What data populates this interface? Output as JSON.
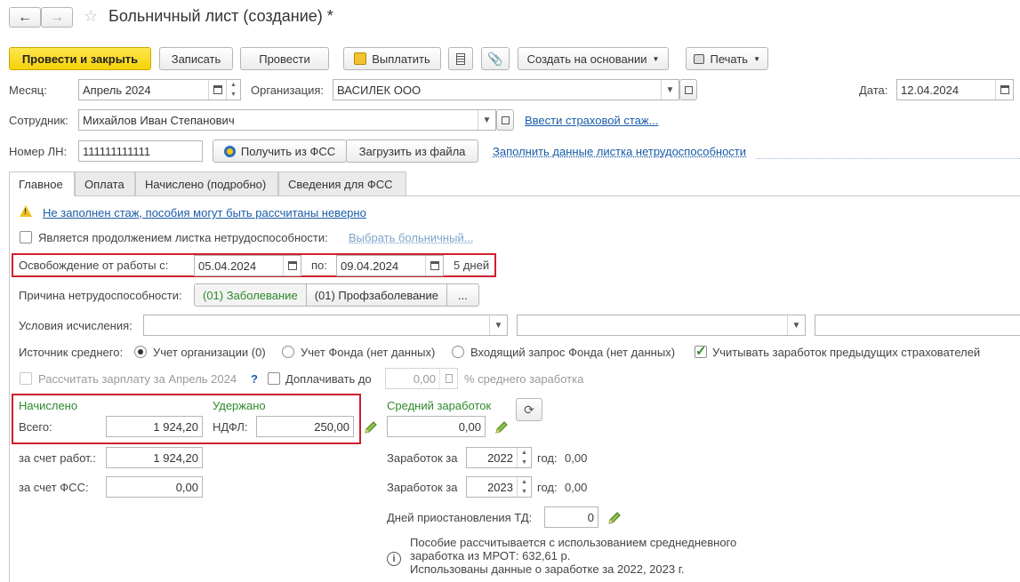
{
  "header": {
    "title": "Больничный лист (создание) *"
  },
  "toolbar": {
    "post_close": "Провести и закрыть",
    "save": "Записать",
    "post": "Провести",
    "pay": "Выплатить",
    "create_based": "Создать на основании",
    "print": "Печать"
  },
  "fields": {
    "month_label": "Месяц:",
    "month_value": "Апрель 2024",
    "org_label": "Организация:",
    "org_value": "ВАСИЛЕК ООО",
    "date_label": "Дата:",
    "date_value": "12.04.2024",
    "employee_label": "Сотрудник:",
    "employee_value": "Михайлов Иван Степанович",
    "insurance_link": "Ввести страховой стаж...",
    "ln_label": "Номер ЛН:",
    "ln_value": "111111111111",
    "get_fss": "Получить из ФСС",
    "load_file": "Загрузить из файла",
    "fill_link": "Заполнить данные листка нетрудоспособности"
  },
  "tabs": [
    "Главное",
    "Оплата",
    "Начислено (подробно)",
    "Сведения для ФСС"
  ],
  "main": {
    "warning_link": "Не заполнен стаж, пособия могут быть рассчитаны неверно",
    "continuation_label": "Является продолжением листка нетрудоспособности:",
    "choose_sick": "Выбрать больничный...",
    "release_label": "Освобождение от работы с:",
    "release_from": "05.04.2024",
    "to_label": "по:",
    "release_to": "09.04.2024",
    "days": "5 дней",
    "reason_label": "Причина нетрудоспособности:",
    "reason_options": [
      "(01) Заболевание",
      "(01) Профзаболевание",
      "..."
    ],
    "conditions_label": "Условия исчисления:",
    "source_label": "Источник среднего:",
    "source_options": [
      "Учет организации (0)",
      "Учет Фонда (нет данных)",
      "Входящий запрос Фонда (нет данных)"
    ],
    "prev_employers": "Учитывать заработок предыдущих страхователей",
    "calc_salary": "Рассчитать зарплату за Апрель 2024",
    "question": "?",
    "extra_pay": "Доплачивать до",
    "extra_value": "0,00",
    "percent_label": "% среднего заработка",
    "accrued_title": "Начислено",
    "total_label": "Всего:",
    "total_value": "1 924,20",
    "withheld_title": "Удержано",
    "ndfl_label": "НДФЛ:",
    "ndfl_value": "250,00",
    "employer_label": "за счет работ.:",
    "employer_value": "1 924,20",
    "fss_label": "за счет ФСС:",
    "fss_value": "0,00",
    "avg_title": "Средний заработок",
    "avg_value": "0,00",
    "earn_label": "Заработок за",
    "year1": "2022",
    "year2": "2023",
    "year_word": "год:",
    "year1_sum": "0,00",
    "year2_sum": "0,00",
    "suspend_label": "Дней приостановления ТД:",
    "suspend_value": "0",
    "info_line1": "Пособие рассчитывается с использованием среднедневного",
    "info_line2": "заработка из МРОТ: 632,61 р.",
    "info_line3": "Использованы данные о заработке за  2022,  2023 г."
  },
  "colors": {
    "primary_button": "#f5d20a",
    "highlight_box": "#d0202c",
    "link": "#1a5ca8",
    "green_label": "#2d8a2d"
  }
}
